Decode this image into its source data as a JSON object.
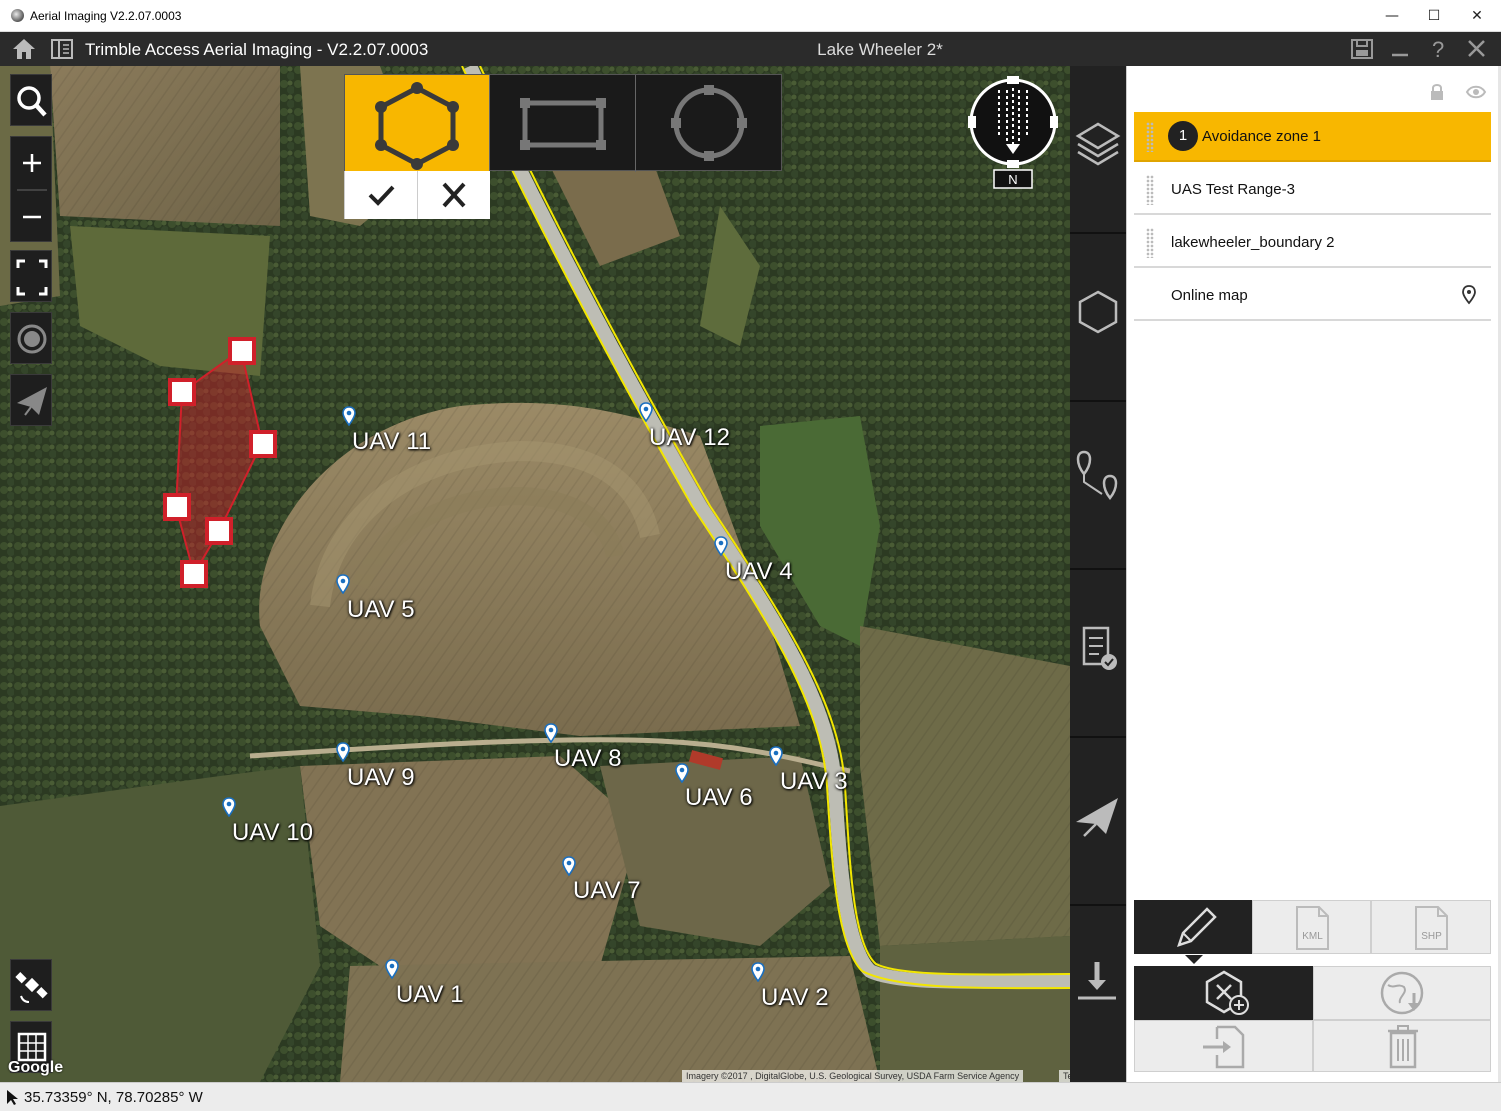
{
  "window": {
    "title": "Aerial Imaging V2.2.07.0003",
    "minimize_glyph": "—",
    "maximize_glyph": "☐",
    "close_glyph": "✕"
  },
  "header": {
    "app_title": "Trimble Access Aerial Imaging - V2.2.07.0003",
    "project_name": "Lake Wheeler 2*",
    "icons": [
      "home-icon",
      "panel-toggle-icon",
      "save-icon",
      "minimize-icon",
      "help-icon",
      "close-icon"
    ]
  },
  "map_tools": {
    "left": [
      "search-icon",
      "zoom-in-icon",
      "zoom-out-icon",
      "fit-extent-icon",
      "locate-icon",
      "send-plane-icon",
      "satellite-icon",
      "grid-icon"
    ],
    "shape_options": [
      "polygon-shape",
      "rectangle-shape",
      "circle-shape"
    ],
    "selected_shape": "polygon-shape",
    "confirm": "checkmark-icon",
    "cancel": "cross-icon",
    "compass_label": "N"
  },
  "markers": [
    {
      "label": "UAV 11"
    },
    {
      "label": "UAV 12"
    },
    {
      "label": "UAV 4"
    },
    {
      "label": "UAV 5"
    },
    {
      "label": "UAV 8"
    },
    {
      "label": "UAV 9"
    },
    {
      "label": "UAV 6"
    },
    {
      "label": "UAV 3"
    },
    {
      "label": "UAV 10"
    },
    {
      "label": "UAV 7"
    },
    {
      "label": "UAV 1"
    },
    {
      "label": "UAV 2"
    }
  ],
  "map_footer": {
    "attribution": "Imagery ©2017 , DigitalGlobe, U.S. Geological Survey, USDA Farm Service Agency",
    "terms": "Terms of Use",
    "logo": "Google"
  },
  "side_rail": [
    "layers-icon",
    "hexagon-icon",
    "route-pin-icon",
    "checklist-icon",
    "send-plane-icon",
    "download-icon"
  ],
  "panel": {
    "header_icons": [
      "lock-icon",
      "eye-icon"
    ],
    "layers": [
      {
        "badge": "1",
        "label": "Avoidance zone 1",
        "selected": true
      },
      {
        "label": "UAS Test Range-3"
      },
      {
        "label": "lakewheeler_boundary 2"
      },
      {
        "label": "Online map"
      }
    ],
    "bottom_tools": {
      "edit": "pencil-icon",
      "kml": "KML",
      "shp": "SHP",
      "add_zone": "add-avoidance-zone-icon",
      "globe": "globe-download-icon",
      "import": "import-icon",
      "delete": "trash-icon"
    }
  },
  "status": {
    "coordinates": "35.73359° N, 78.70285° W"
  },
  "colors": {
    "accent": "#f8b700",
    "header_bg": "#2b2b2b",
    "zone_red": "#d0202a",
    "road_yellow": "#f2e600"
  }
}
